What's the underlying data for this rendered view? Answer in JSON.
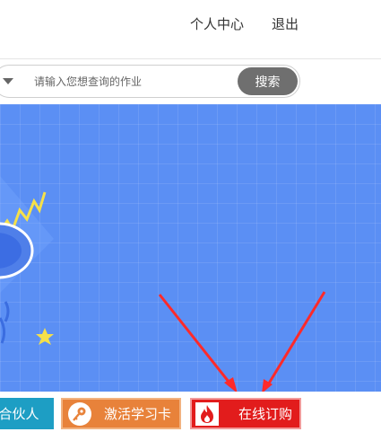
{
  "nav": {
    "personal_center": "个人中心",
    "logout": "退出"
  },
  "search": {
    "placeholder": "请输入您想查询的作业",
    "button": "搜索"
  },
  "actions": {
    "partner": "合伙人",
    "activate_card": "激活学习卡",
    "order_online": "在线订购"
  },
  "colors": {
    "banner_bg": "#5b8ff4",
    "partner": "#1d9ec4",
    "activate": "#e8823a",
    "order": "#e21c1c",
    "annotation_arrows": "#ff2a2a"
  },
  "icons": {
    "activate_card": "key-icon",
    "order_online": "fire-icon"
  }
}
